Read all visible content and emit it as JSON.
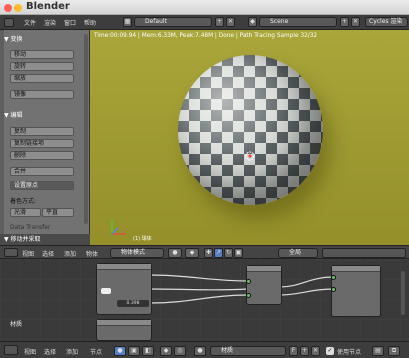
{
  "titlebar": {
    "title": "Blender"
  },
  "info": {
    "menus": [
      "文件",
      "渲染",
      "窗口",
      "帮助"
    ],
    "screen_layout": "Default",
    "scene": "Scene",
    "render_engine": "Cycles 渲染"
  },
  "viewport": {
    "status": "Time:00:09.94 | Mem:6.33M, Peak:7.48M | Done | Path Tracing Sample 32/32",
    "object_label": "(1) 球体"
  },
  "toolshelf": {
    "transform_header": "▼ 变换",
    "transform_buttons": [
      "移动",
      "旋转",
      "缩放",
      "镜像"
    ],
    "edit_header": "▼ 编辑",
    "edit_buttons": [
      "复制",
      "复制链接项",
      "删除",
      "合并"
    ],
    "origin_select": "设置原点",
    "shading_label": "着色方式:",
    "shading_smooth": "光滑",
    "shading_flat": "平直",
    "data_transfer": "Data Transfer",
    "redo_header": "▼ 移动并采取"
  },
  "node_header": {
    "menus": [
      "视图",
      "选择",
      "添加",
      "物体"
    ],
    "mode": "物体模式",
    "global": "全局"
  },
  "nodes": {
    "frame_label": "材质",
    "value_field": "0.398"
  },
  "footer": {
    "menus": [
      "视图",
      "选择",
      "添加",
      "节点"
    ],
    "material": "材质",
    "use_nodes": "使用节点"
  },
  "colors": {
    "viewport_bg": "#aaa63a",
    "toolshelf_bg": "#727272",
    "header_bg": "#3d3d3d"
  }
}
